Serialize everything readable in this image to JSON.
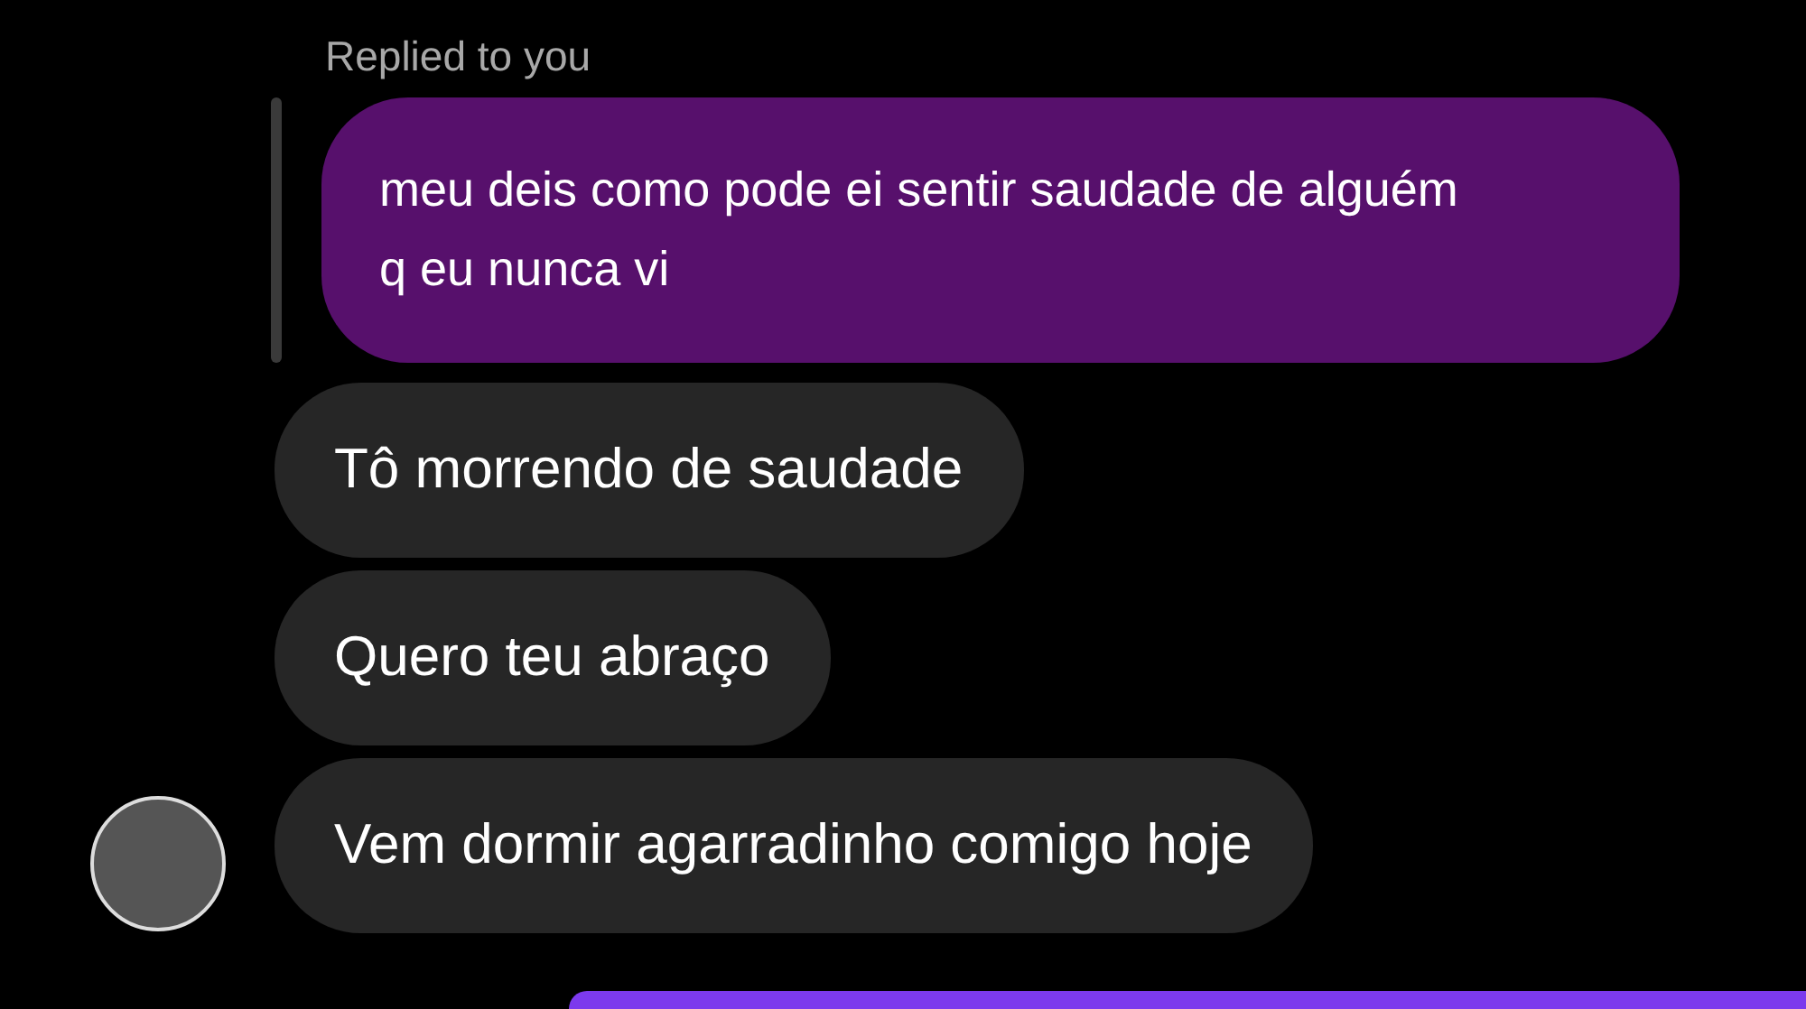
{
  "reply": {
    "label": "Replied to you",
    "quoted_text": "meu deis como pode ei sentir saudade de alguém q eu nunca vi"
  },
  "messages": [
    {
      "text": "Tô morrendo de saudade",
      "show_avatar": false
    },
    {
      "text": "Quero teu abraço",
      "show_avatar": false
    },
    {
      "text": "Vem dormir agarradinho comigo hoje",
      "show_avatar": true
    }
  ]
}
